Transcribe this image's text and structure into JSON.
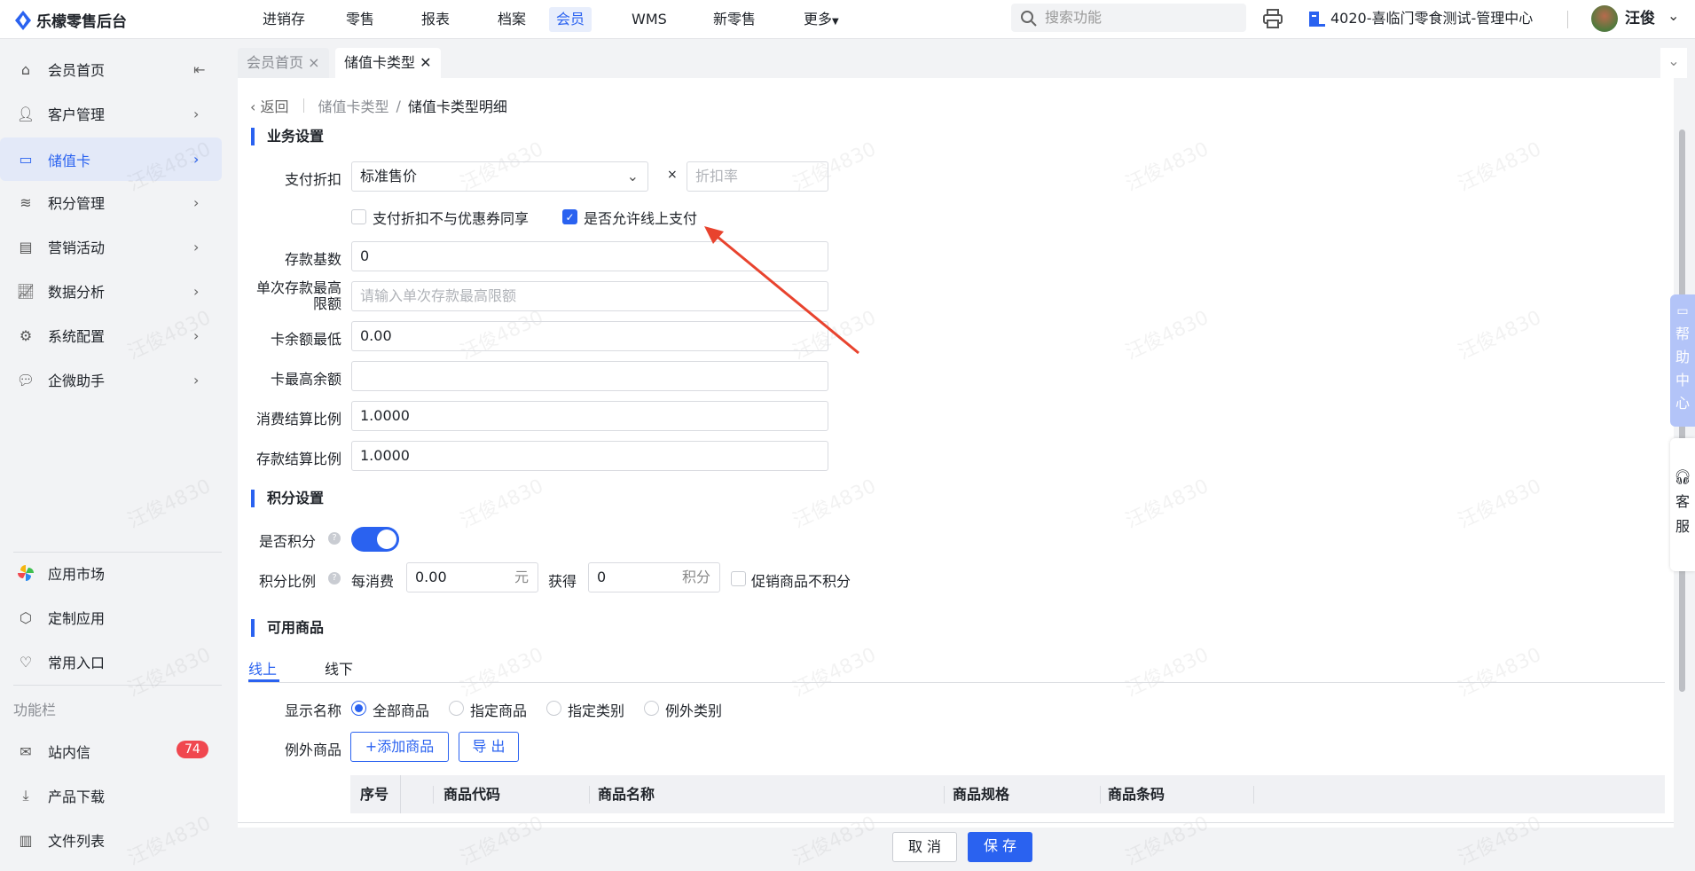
{
  "header": {
    "app_name": "乐檬零售后台",
    "nav": [
      "进销存",
      "零售",
      "报表",
      "档案",
      "会员",
      "WMS",
      "新零售",
      "更多"
    ],
    "active_nav": "会员",
    "search_placeholder": "搜索功能",
    "org": "4020-喜临门零食测试-管理中心",
    "user": "汪俊"
  },
  "sidebar": {
    "items": [
      {
        "label": "会员首页"
      },
      {
        "label": "客户管理"
      },
      {
        "label": "储值卡"
      },
      {
        "label": "积分管理"
      },
      {
        "label": "营销活动"
      },
      {
        "label": "数据分析"
      },
      {
        "label": "系统配置"
      },
      {
        "label": "企微助手"
      }
    ],
    "bottom": [
      {
        "label": "应用市场"
      },
      {
        "label": "定制应用"
      },
      {
        "label": "常用入口"
      }
    ],
    "section_title": "功能栏",
    "tools": [
      {
        "label": "站内信",
        "badge": "74"
      },
      {
        "label": "产品下载"
      },
      {
        "label": "文件列表"
      }
    ]
  },
  "tabs": [
    {
      "label": "会员首页"
    },
    {
      "label": "储值卡类型"
    }
  ],
  "breadcrumb": {
    "back": "返回",
    "parent": "储值卡类型",
    "current": "储值卡类型明细"
  },
  "business": {
    "title": "业务设置",
    "pay_discount_label": "支付折扣",
    "pay_discount_value": "标准售价",
    "times": "×",
    "discount_rate_placeholder": "折扣率",
    "cb_no_coupon": "支付折扣不与优惠券同享",
    "cb_online": "是否允许线上支付",
    "deposit_base_label": "存款基数",
    "deposit_base": "0",
    "single_max_label_1": "单次存款最高",
    "single_max_label_2": "限额",
    "single_max_placeholder": "请输入单次存款最高限额",
    "min_balance_label": "卡余额最低",
    "min_balance": "0.00",
    "max_balance_label": "卡最高余额",
    "max_balance": "",
    "consume_ratio_label": "消费结算比例",
    "consume_ratio": "1.0000",
    "deposit_ratio_label": "存款结算比例",
    "deposit_ratio": "1.0000"
  },
  "points": {
    "title": "积分设置",
    "enable_label": "是否积分",
    "enabled": true,
    "ratio_label": "积分比例",
    "per_spend": "每消费",
    "spend_value": "0.00",
    "yuan": "元",
    "get": "获得",
    "points_value": "0",
    "points_unit": "积分",
    "promo_no_points": "促销商品不积分"
  },
  "goods": {
    "title": "可用商品",
    "tabs": [
      "线上",
      "线下"
    ],
    "display_label": "显示名称",
    "radios": [
      "全部商品",
      "指定商品",
      "指定类别",
      "例外类别"
    ],
    "exception_label": "例外商品",
    "add_button": "+添加商品",
    "export_button": "导 出",
    "columns": [
      "序号",
      "商品代码",
      "商品名称",
      "商品规格",
      "商品条码"
    ]
  },
  "footer": {
    "cancel": "取 消",
    "save": "保 存"
  },
  "floating": {
    "help": [
      "帮",
      "助",
      "中",
      "心"
    ],
    "service": [
      "客",
      "服"
    ]
  },
  "watermark": "汪俊4830",
  "colors": {
    "accent": "#2a62f0",
    "badge": "#f0474f",
    "arrow": "#e8432e"
  }
}
